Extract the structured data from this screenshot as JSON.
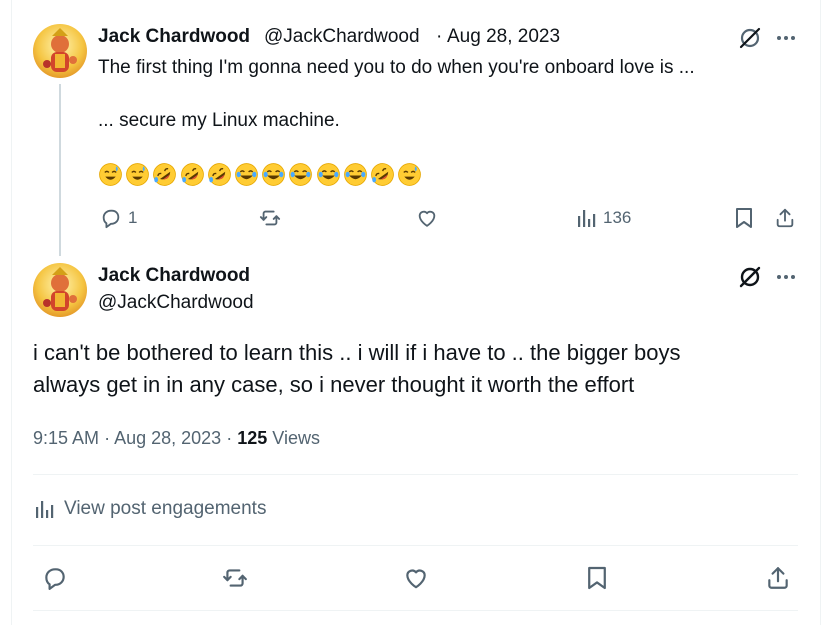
{
  "parent_tweet": {
    "display_name": "Jack Chardwood",
    "handle": "@JackChardwood",
    "separator": "·",
    "date": "Aug 28, 2023",
    "line1": "The first thing I'm gonna need you to do when you're onboard love is ...",
    "line2": "... secure my Linux machine.",
    "emojis": [
      "sweat-smile",
      "sweat-smile",
      "rofl",
      "rofl",
      "rofl",
      "joy",
      "joy",
      "joy",
      "joy",
      "joy",
      "rofl",
      "sweat-smile"
    ],
    "reply_count": "1",
    "view_count": "136"
  },
  "main_tweet": {
    "display_name": "Jack Chardwood",
    "handle": "@JackChardwood",
    "text_line1": "i can't be bothered to learn this .. i will if i have to .. the bigger boys",
    "text_line2": "always get in in any case, so i never thought it worth the effort",
    "time": "9:15 AM",
    "sep": "·",
    "date": "Aug 28, 2023",
    "sep2": "·",
    "views_count": "125",
    "views_label": "Views",
    "engagements_label": "View post engagements"
  },
  "colors": {
    "text_primary": "#0f1419",
    "text_secondary": "#536471",
    "divider": "#eff3f4",
    "thread_line": "#cfd9de"
  },
  "icons": [
    "grok-icon",
    "more-icon",
    "reply-icon",
    "retweet-icon",
    "like-icon",
    "analytics-icon",
    "bookmark-icon",
    "share-icon"
  ]
}
